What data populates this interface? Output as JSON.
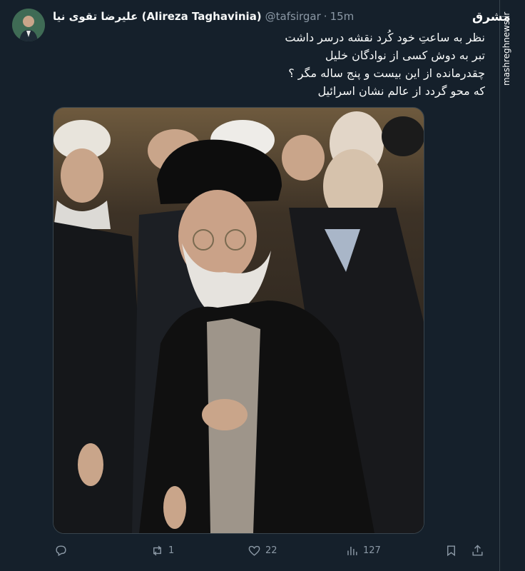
{
  "author": {
    "display_name": "علیرضا تقوی نیا (Alireza Taghavinia)",
    "handle": "@tafsirgar",
    "separator": "·",
    "time": "15m"
  },
  "tweet": {
    "lines": [
      "نظر به ساعتِ خود کُرد نقشه درسر داشت",
      "تبر به دوش کسی از نوادگان خلیل",
      "چقدرمانده از این بیست و پنج ساله مگر ؟",
      "که محو گردد از عالم نشان اسرائیل"
    ]
  },
  "actions": {
    "reply": {
      "icon": "reply-icon",
      "count": ""
    },
    "retweet": {
      "icon": "retweet-icon",
      "count": "1"
    },
    "like": {
      "icon": "heart-icon",
      "count": "22"
    },
    "views": {
      "icon": "views-icon",
      "count": "127"
    },
    "bookmark": {
      "icon": "bookmark-icon"
    },
    "share": {
      "icon": "share-icon"
    }
  },
  "watermark": {
    "logo": "مشرق",
    "site": "mashreghnews.ir"
  },
  "colors": {
    "background": "#15202b",
    "text": "#f7f9f9",
    "muted": "#8b98a5",
    "border": "#38444d"
  }
}
